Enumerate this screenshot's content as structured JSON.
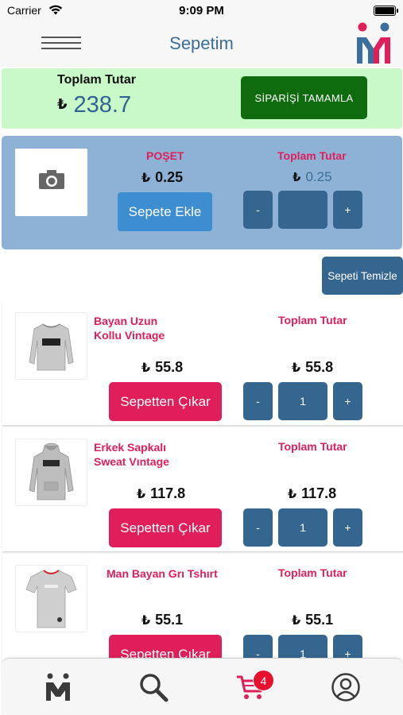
{
  "status_bar": {
    "carrier": "Carrier",
    "time": "9:09 PM"
  },
  "nav": {
    "title": "Sepetim"
  },
  "summary": {
    "label": "Toplam Tutar",
    "currency": "₺",
    "amount": "238.7",
    "complete_button": "SİPARİŞİ TAMAMLA"
  },
  "bag": {
    "name": "POŞET",
    "currency": "₺",
    "price": "0.25",
    "total_label": "Toplam Tutar",
    "total": "0.25",
    "add_button": "Sepete Ekle",
    "minus": "-",
    "plus": "+",
    "quantity": "",
    "placeholder_image": "camera-icon"
  },
  "clear_button": "Sepeti Temizle",
  "items": [
    {
      "name": "Bayan Uzun\nKollu Vintage",
      "price": "55.8",
      "total_label": "Toplam Tutar",
      "total": "55.8",
      "remove_button": "Sepetten Çıkar",
      "minus": "-",
      "quantity": "1",
      "plus": "+",
      "currency": "₺"
    },
    {
      "name": "Erkek Sapkalı\nSweat Vıntage",
      "price": "117.8",
      "total_label": "Toplam Tutar",
      "total": "117.8",
      "remove_button": "Sepetten Çıkar",
      "minus": "-",
      "quantity": "1",
      "plus": "+",
      "currency": "₺"
    },
    {
      "name": "Man Bayan Grı Tshırt",
      "price": "55.1",
      "total_label": "Toplam Tutar",
      "total": "55.1",
      "remove_button": "Sepetten Çıkar",
      "minus": "-",
      "quantity": "1",
      "plus": "+",
      "currency": "₺"
    }
  ],
  "tab_bar": {
    "tabs": [
      {
        "icon": "logo-icon"
      },
      {
        "icon": "search-icon"
      },
      {
        "icon": "cart-icon",
        "badge": "4"
      },
      {
        "icon": "profile-icon"
      }
    ]
  },
  "colors": {
    "accent_red": "#e01e5a",
    "primary_blue": "#35668f",
    "complete_green": "#0e6b0e",
    "summary_bg": "#c9f9c8",
    "bag_bg": "#8eb2d6"
  }
}
